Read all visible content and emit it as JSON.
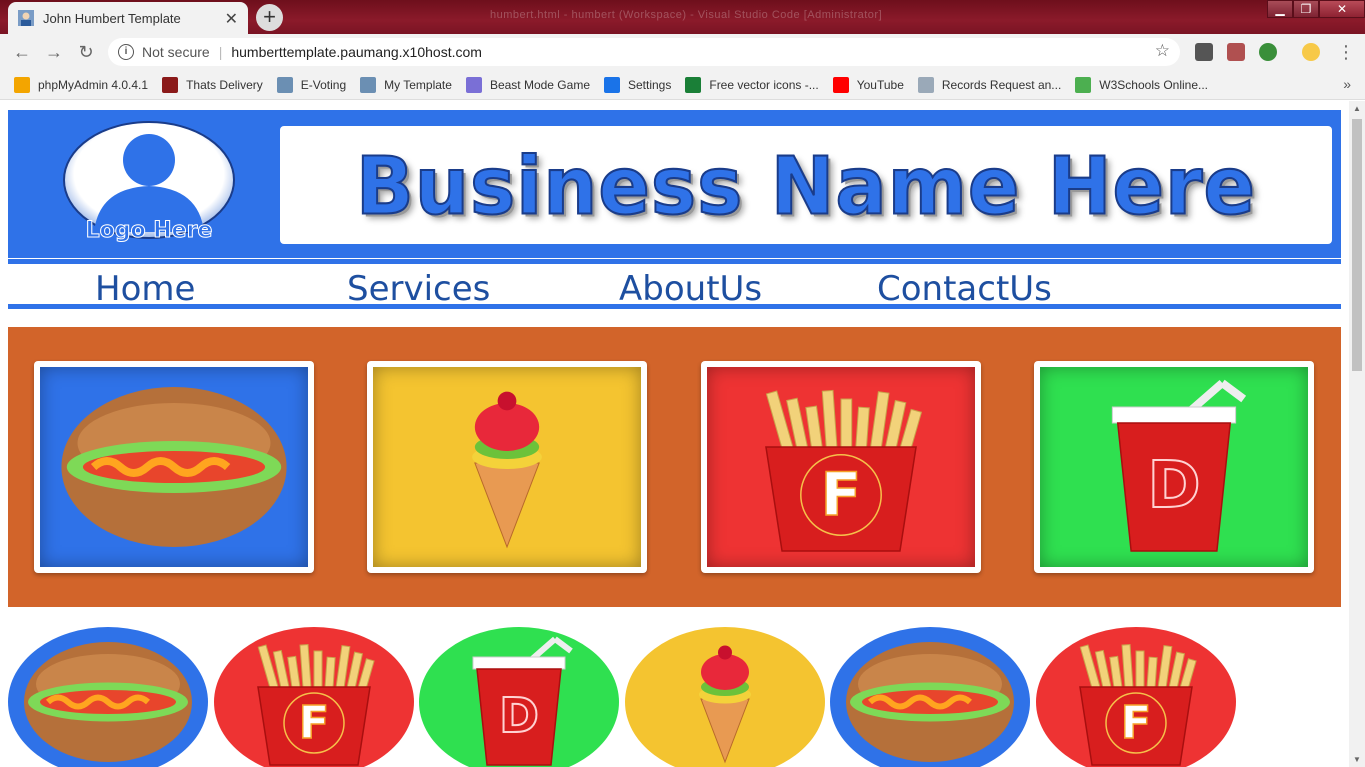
{
  "browser": {
    "tab_title": "John Humbert Template",
    "new_tab_icon": "plus-icon",
    "window_title_faint": "humbert.html - humbert (Workspace) - Visual Studio Code [Administrator]",
    "security_label": "Not secure",
    "url": "humberttemplate.paumang.x10host.com",
    "bookmarks": [
      {
        "label": "phpMyAdmin 4.0.4.1",
        "color": "#f3a500"
      },
      {
        "label": "Thats Delivery",
        "color": "#8b1a1a"
      },
      {
        "label": "E-Voting",
        "color": "#6b8fb3"
      },
      {
        "label": "My Template",
        "color": "#6b8fb3"
      },
      {
        "label": "Beast Mode Game",
        "color": "#7a6fd6"
      },
      {
        "label": "Settings",
        "color": "#1a73e8"
      },
      {
        "label": "Free vector icons -...",
        "color": "#1a7f37"
      },
      {
        "label": "YouTube",
        "color": "#ff0000"
      },
      {
        "label": "Records Request an...",
        "color": "#9aa9b8"
      },
      {
        "label": "W3Schools Online...",
        "color": "#4caf50"
      }
    ]
  },
  "page": {
    "logo_text": "Logo Here",
    "business_name": "Business Name Here",
    "nav": [
      "Home",
      "Services",
      "AboutUs",
      "ContactUs"
    ],
    "gallery": [
      {
        "item": "hotdog",
        "bg": "#2f72e8"
      },
      {
        "item": "ice-cream",
        "bg": "#f4c430"
      },
      {
        "item": "fries",
        "bg": "#ee3333"
      },
      {
        "item": "drink",
        "bg": "#2fe050"
      }
    ],
    "ovals": [
      {
        "item": "hotdog",
        "bg": "#2f72e8"
      },
      {
        "item": "fries",
        "bg": "#ee3333"
      },
      {
        "item": "drink",
        "bg": "#2fe050"
      },
      {
        "item": "ice-cream",
        "bg": "#f4c430"
      },
      {
        "item": "hotdog",
        "bg": "#2f72e8"
      },
      {
        "item": "fries",
        "bg": "#ee3333"
      }
    ],
    "letters": {
      "fries": "F",
      "drink": "D"
    },
    "colors": {
      "brand_blue": "#2f72e8",
      "nav_text": "#1e4fa0",
      "gallery_bg": "#d2642a"
    }
  }
}
